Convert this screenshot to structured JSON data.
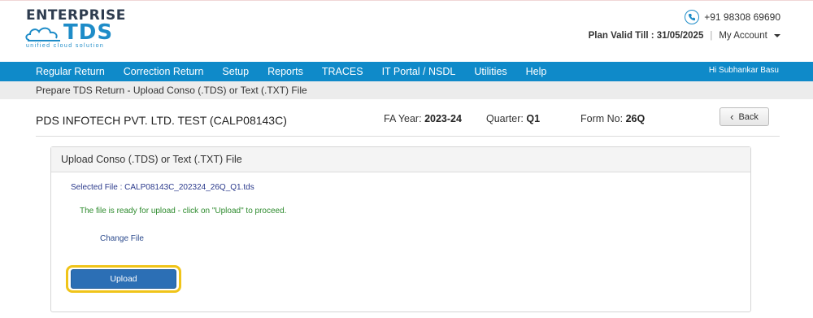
{
  "brand": {
    "logo_top": "ENTERPRISE",
    "logo_main": "TDS",
    "logo_tagline": "unified cloud solution"
  },
  "contact": {
    "phone": "+91 98308 69690",
    "plan_label": "Plan Valid Till : 31/05/2025",
    "separator": "|",
    "account_label": "My Account"
  },
  "nav": {
    "items": [
      "Regular Return",
      "Correction Return",
      "Setup",
      "Reports",
      "TRACES",
      "IT Portal / NSDL",
      "Utilities",
      "Help"
    ],
    "user_greeting": "Hi Subhankar Basu"
  },
  "breadcrumb": "Prepare TDS Return - Upload Conso (.TDS) or Text (.TXT) File",
  "info": {
    "company": "PDS INFOTECH PVT. LTD. TEST (CALP08143C)",
    "fa_year_label": "FA Year:",
    "fa_year_value": "2023-24",
    "quarter_label": "Quarter:",
    "quarter_value": "Q1",
    "form_label": "Form No:",
    "form_value": "26Q",
    "back_label": "Back"
  },
  "panel": {
    "title": "Upload Conso (.TDS) or Text (.TXT) File",
    "selected_file": "Selected File : CALP08143C_202324_26Q_Q1.tds",
    "ready_message": "The file is ready for upload - click on \"Upload\" to proceed.",
    "change_file": "Change File",
    "upload_label": "Upload"
  },
  "colors": {
    "navbar": "#0f8ac9",
    "accent": "#1e8cc8",
    "upload_button": "#2c6fb5",
    "highlight": "#f0c419",
    "success_text": "#2e8b2e"
  },
  "icons": {
    "phone": "phone-icon",
    "back": "chevron-left-icon",
    "dropdown": "caret-down-icon",
    "logo": "cloud-icon"
  }
}
